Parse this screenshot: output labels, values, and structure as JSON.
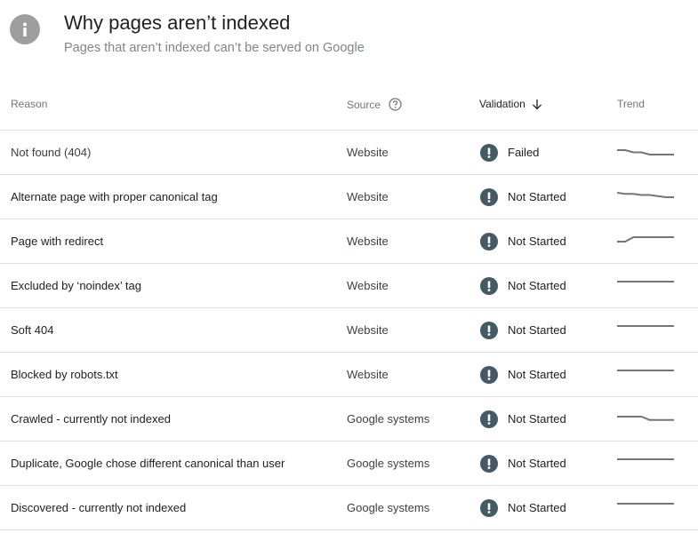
{
  "header": {
    "icon": "info-icon",
    "title": "Why pages aren’t indexed",
    "subtitle": "Pages that aren’t indexed can’t be served on Google"
  },
  "table": {
    "columns": {
      "reason": "Reason",
      "source": "Source",
      "source_help_icon": "help-circle-icon",
      "validation": "Validation",
      "validation_sort_icon": "arrow-down-icon",
      "trend": "Trend"
    },
    "status_icon": "alert-circle-icon",
    "colors": {
      "status_icon": "#455a64",
      "sparkline": "#757575",
      "divider": "#e0e0e0"
    },
    "rows": [
      {
        "reason": "Not found (404)",
        "source": "Website",
        "validation": "Failed",
        "trend": [
          1.0,
          1.0,
          0.8,
          0.8,
          0.6,
          0.6,
          0.6,
          0.6
        ]
      },
      {
        "reason": "Alternate page with proper canonical tag",
        "source": "Website",
        "validation": "Not Started",
        "trend": [
          1.0,
          0.9,
          0.9,
          0.8,
          0.8,
          0.7,
          0.6,
          0.6
        ]
      },
      {
        "reason": "Page with redirect",
        "source": "Website",
        "validation": "Not Started",
        "trend": [
          0.6,
          0.6,
          1.0,
          1.0,
          1.0,
          1.0,
          1.0,
          1.0
        ]
      },
      {
        "reason": "Excluded by ‘noindex’ tag",
        "source": "Website",
        "validation": "Not Started",
        "trend": [
          1,
          1,
          1,
          1,
          1,
          1,
          1,
          1
        ]
      },
      {
        "reason": "Soft 404",
        "source": "Website",
        "validation": "Not Started",
        "trend": [
          1,
          1,
          1,
          1,
          1,
          1,
          1,
          1
        ]
      },
      {
        "reason": "Blocked by robots.txt",
        "source": "Website",
        "validation": "Not Started",
        "trend": [
          1,
          1,
          1,
          1,
          1,
          1,
          1,
          1
        ]
      },
      {
        "reason": "Crawled - currently not indexed",
        "source": "Google systems",
        "validation": "Not Started",
        "trend": [
          1.0,
          1.0,
          1.0,
          1.0,
          0.7,
          0.7,
          0.7,
          0.7
        ]
      },
      {
        "reason": "Duplicate, Google chose different canonical than user",
        "source": "Google systems",
        "validation": "Not Started",
        "trend": [
          1,
          1,
          1,
          1,
          1,
          1,
          1,
          1
        ]
      },
      {
        "reason": "Discovered - currently not indexed",
        "source": "Google systems",
        "validation": "Not Started",
        "trend": [
          1,
          1,
          1,
          1,
          1,
          1,
          1,
          1
        ]
      }
    ]
  }
}
